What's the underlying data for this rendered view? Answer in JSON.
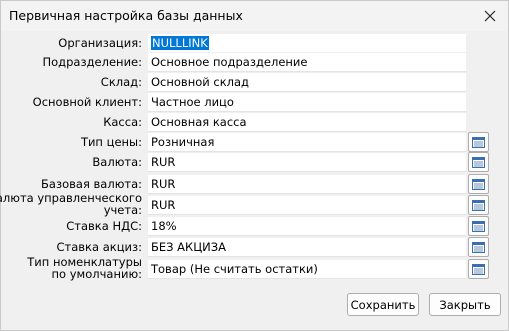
{
  "window": {
    "title": "Первичная настройка базы данных"
  },
  "fields": [
    {
      "label": "Организация:",
      "value": "NULLLINK",
      "picker": false
    },
    {
      "label": "Подразделение:",
      "value": "Основное подразделение",
      "picker": false
    },
    {
      "label": "Склад:",
      "value": "Основной склад",
      "picker": false
    },
    {
      "label": "Основной клиент:",
      "value": "Частное лицо",
      "picker": false
    },
    {
      "label": "Касса:",
      "value": "Основная касса",
      "picker": false
    },
    {
      "label": "Тип цены:",
      "value": "Розничная",
      "picker": true
    },
    {
      "label": "Валюта:",
      "value": "RUR",
      "picker": true
    },
    {
      "label": "Базовая валюта:",
      "value": "RUR",
      "picker": true
    },
    {
      "label": "Валюта управленческого учета:",
      "label_line1": "Валюта управленческого",
      "label_line2": "учета:",
      "value": "RUR",
      "picker": true
    },
    {
      "label": "Ставка НДС:",
      "value": "18%",
      "picker": true
    },
    {
      "label": "Ставка акциз:",
      "value": "БЕЗ АКЦИЗА",
      "picker": true
    },
    {
      "label": "Тип номенклатуры по умолчанию:",
      "label_line1": "Тип номенклатуры",
      "label_line2": "по умолчанию:",
      "value": "Товар (Не считать остатки)",
      "picker": true
    }
  ],
  "buttons": {
    "save": "Сохранить",
    "close": "Закрыть"
  },
  "icons": {
    "close": "close-icon",
    "picker": "list-picker-icon"
  },
  "colors": {
    "selection": "#0078d7",
    "background": "#f0f0f0"
  }
}
